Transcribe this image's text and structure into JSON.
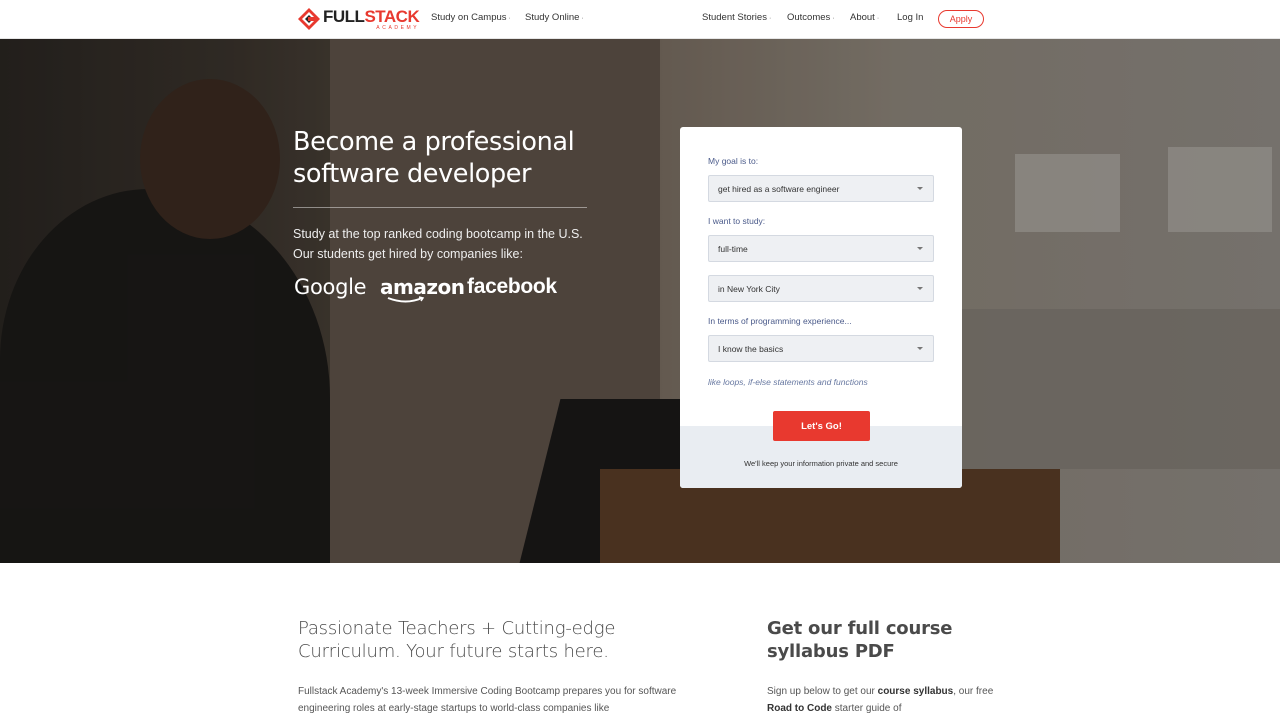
{
  "brand": {
    "name_part1": "FULL",
    "name_part2": "STACK",
    "tagline": "ACADEMY",
    "accent_color": "#e8392f"
  },
  "nav": {
    "left_items": [
      {
        "label": "Study on Campus",
        "caret": "·"
      },
      {
        "label": "Study Online",
        "caret": "·"
      }
    ],
    "right_items": [
      {
        "label": "Student Stories",
        "caret": "·"
      },
      {
        "label": "Outcomes",
        "caret": "·"
      },
      {
        "label": "About",
        "caret": "·"
      },
      {
        "label": "Log In",
        "caret": ""
      }
    ],
    "apply_label": "Apply"
  },
  "hero": {
    "title": "Become a professional software developer",
    "subtitle": "Study at the top ranked coding bootcamp in the U.S. Our students get hired by companies like:",
    "companies": [
      "Google",
      "amazon",
      "facebook"
    ]
  },
  "form": {
    "goal_label": "My goal is to:",
    "goal_value": "get hired as a software engineer",
    "study_label": "I want to study:",
    "study_value": "full-time",
    "location_value": "in New York City",
    "experience_label": "In terms of programming experience...",
    "experience_value": "I know the basics",
    "experience_hint": "like loops, if-else statements and functions",
    "submit_label": "Let's Go!",
    "privacy_note": "We'll keep your information private and secure"
  },
  "lower": {
    "left_heading": "Passionate Teachers + Cutting-edge Curriculum. Your future starts here.",
    "left_text": "Fullstack Academy's 13-week Immersive Coding Bootcamp prepares you for software engineering roles at early-stage startups to world-class companies like",
    "right_heading": "Get our full course syllabus PDF",
    "right_text_1": "Sign up below to get our ",
    "right_bold_1": "course syllabus",
    "right_text_2": ", our free ",
    "right_bold_2": "Road to Code",
    "right_text_3": " starter guide of"
  }
}
